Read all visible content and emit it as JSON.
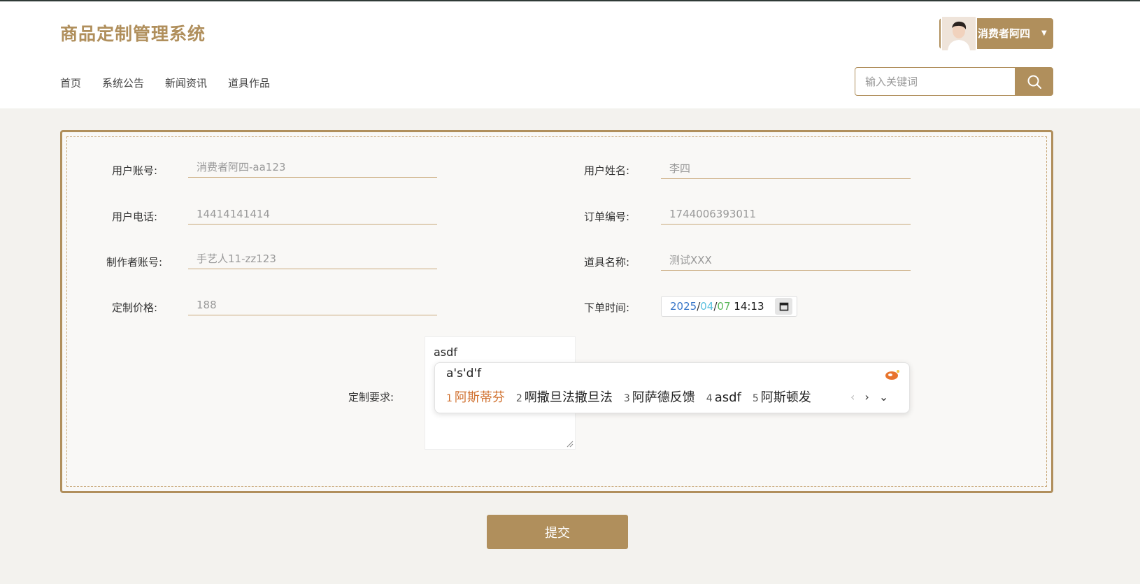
{
  "brand": "商品定制管理系统",
  "nav": [
    "首页",
    "系统公告",
    "新闻资讯",
    "道具作品"
  ],
  "user": {
    "name": "消费者阿四"
  },
  "search": {
    "placeholder": "输入关键词"
  },
  "form": {
    "user_account": {
      "label": "用户账号:",
      "value": "消费者阿四-aa123"
    },
    "user_name": {
      "label": "用户姓名:",
      "value": "李四"
    },
    "user_phone": {
      "label": "用户电话:",
      "value": "14414141414"
    },
    "order_no": {
      "label": "订单编号:",
      "value": "1744006393011"
    },
    "maker_account": {
      "label": "制作者账号:",
      "value": "手艺人11-zz123"
    },
    "prop_name": {
      "label": "道具名称:",
      "value": "测试XXX"
    },
    "price": {
      "label": "定制价格:",
      "value": "188"
    },
    "order_time": {
      "label": "下单时间:",
      "year": "2025",
      "month": "04",
      "day": "07",
      "time": "14:13"
    },
    "requirement": {
      "label": "定制要求:",
      "value": "asdf"
    }
  },
  "ime": {
    "composition": "a's'd'f",
    "candidates": [
      {
        "num": "1",
        "text": "阿斯蒂芬"
      },
      {
        "num": "2",
        "text": "啊撒旦法撒旦法"
      },
      {
        "num": "3",
        "text": "阿萨德反馈"
      },
      {
        "num": "4",
        "text": "asdf"
      },
      {
        "num": "5",
        "text": "阿斯顿发"
      }
    ]
  },
  "submit_label": "提交",
  "colors": {
    "accent": "#b08f5c",
    "active_candidate": "#d0702e"
  }
}
